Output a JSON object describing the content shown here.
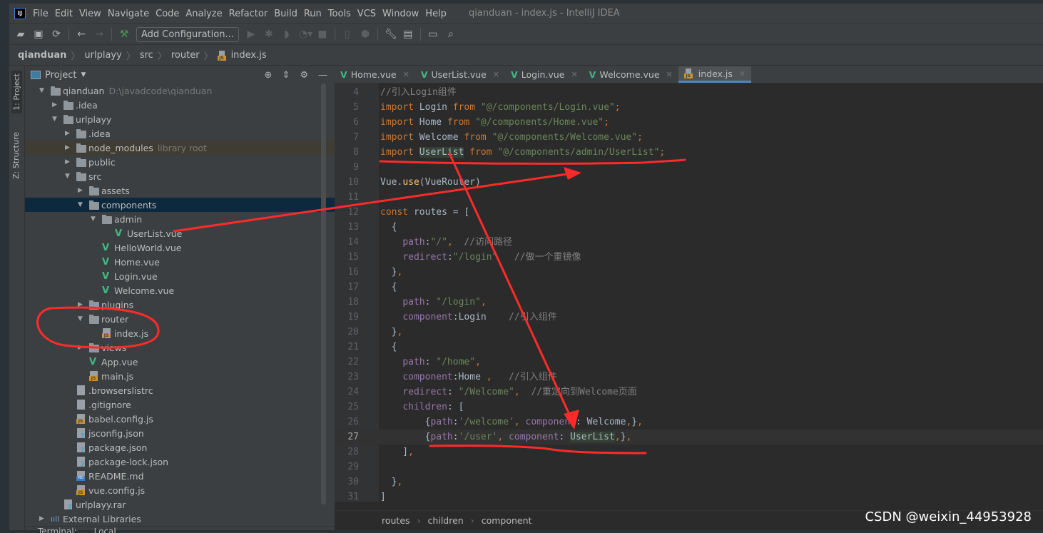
{
  "menubar": {
    "items": [
      "File",
      "Edit",
      "View",
      "Navigate",
      "Code",
      "Analyze",
      "Refactor",
      "Build",
      "Run",
      "Tools",
      "VCS",
      "Window",
      "Help"
    ],
    "window_title": "qianduan - index.js - IntelliJ IDEA"
  },
  "toolbar": {
    "add_configuration": "Add Configuration..."
  },
  "breadcrumb": [
    "qianduan",
    "urlplayy",
    "src",
    "router",
    "index.js"
  ],
  "left_strip": {
    "project": "1: Project",
    "structure": "Z: Structure"
  },
  "project_panel": {
    "title": "Project",
    "tree": [
      {
        "label": "qianduan",
        "extra": "D:\\javadcode\\qianduan",
        "level": 0,
        "type": "folder",
        "expanded": true
      },
      {
        "label": ".idea",
        "level": 1,
        "type": "folder",
        "expanded": false
      },
      {
        "label": "urlplayy",
        "level": 1,
        "type": "folder",
        "expanded": true
      },
      {
        "label": ".idea",
        "level": 2,
        "type": "folder",
        "expanded": false
      },
      {
        "label": "node_modules",
        "extra": "library root",
        "level": 2,
        "type": "folder",
        "expanded": false,
        "state": "library"
      },
      {
        "label": "public",
        "level": 2,
        "type": "folder",
        "expanded": false
      },
      {
        "label": "src",
        "level": 2,
        "type": "folder",
        "expanded": true
      },
      {
        "label": "assets",
        "level": 3,
        "type": "folder",
        "expanded": false
      },
      {
        "label": "components",
        "level": 3,
        "type": "folder",
        "expanded": true,
        "state": "selected"
      },
      {
        "label": "admin",
        "level": 4,
        "type": "folder",
        "expanded": true
      },
      {
        "label": "UserList.vue",
        "level": 5,
        "type": "vue"
      },
      {
        "label": "HelloWorld.vue",
        "level": 4,
        "type": "vue"
      },
      {
        "label": "Home.vue",
        "level": 4,
        "type": "vue"
      },
      {
        "label": "Login.vue",
        "level": 4,
        "type": "vue"
      },
      {
        "label": "Welcome.vue",
        "level": 4,
        "type": "vue"
      },
      {
        "label": "plugins",
        "level": 3,
        "type": "folder",
        "expanded": false
      },
      {
        "label": "router",
        "level": 3,
        "type": "folder",
        "expanded": true
      },
      {
        "label": "index.js",
        "level": 4,
        "type": "js"
      },
      {
        "label": "views",
        "level": 3,
        "type": "folder",
        "expanded": false
      },
      {
        "label": "App.vue",
        "level": 3,
        "type": "vue"
      },
      {
        "label": "main.js",
        "level": 3,
        "type": "js"
      },
      {
        "label": ".browserslistrc",
        "level": 2,
        "type": "file"
      },
      {
        "label": ".gitignore",
        "level": 2,
        "type": "file"
      },
      {
        "label": "babel.config.js",
        "level": 2,
        "type": "js"
      },
      {
        "label": "jsconfig.json",
        "level": 2,
        "type": "json"
      },
      {
        "label": "package.json",
        "level": 2,
        "type": "json"
      },
      {
        "label": "package-lock.json",
        "level": 2,
        "type": "json"
      },
      {
        "label": "README.md",
        "level": 2,
        "type": "md"
      },
      {
        "label": "vue.config.js",
        "level": 2,
        "type": "js"
      },
      {
        "label": "urlplayy.rar",
        "level": 1,
        "type": "unknown"
      },
      {
        "label": "External Libraries",
        "level": 0,
        "type": "libraries",
        "expanded": false
      }
    ]
  },
  "bottom_tool": {
    "label": "Terminal:",
    "tab": "Local"
  },
  "editor": {
    "tabs": [
      {
        "label": "Home.vue",
        "type": "vue"
      },
      {
        "label": "UserList.vue",
        "type": "vue"
      },
      {
        "label": "Login.vue",
        "type": "vue"
      },
      {
        "label": "Welcome.vue",
        "type": "vue"
      },
      {
        "label": "index.js",
        "type": "js",
        "active": true
      }
    ],
    "current_line": 27,
    "lines": [
      {
        "n": 4,
        "html": "<span class=\"cm\">//引入Login组件</span>"
      },
      {
        "n": 5,
        "html": "<span class=\"kw\">import</span> Login <span class=\"kw\">from</span> <span class=\"str\">\"@/components/Login.vue\"</span><span class=\"kw\">;</span>"
      },
      {
        "n": 6,
        "html": "<span class=\"kw\">import</span> Home <span class=\"kw\">from</span> <span class=\"str\">\"@/components/Home.vue\"</span><span class=\"kw\">;</span>"
      },
      {
        "n": 7,
        "html": "<span class=\"kw\">import</span> Welcome <span class=\"kw\">from</span> <span class=\"str\">\"@/components/Welcome.vue\"</span><span class=\"kw\">;</span>"
      },
      {
        "n": 8,
        "html": "<span class=\"kw\">import</span> <span class=\"hl\">UserList</span> <span class=\"kw\">from</span> <span class=\"str\">\"@/components/admin/UserList\"</span><span class=\"kw\">;</span>"
      },
      {
        "n": 9,
        "html": ""
      },
      {
        "n": 10,
        "html": "Vue.<span class=\"fn\">use</span>(VueRouter)"
      },
      {
        "n": 11,
        "html": ""
      },
      {
        "n": 12,
        "html": "<span class=\"kw\">const</span> routes = ["
      },
      {
        "n": 13,
        "html": "  {"
      },
      {
        "n": 14,
        "html": "    <span class=\"prop\">path</span>:<span class=\"str\">\"/\"</span><span class=\"kw\">,</span>  <span class=\"cm\">//访问路径</span>"
      },
      {
        "n": 15,
        "html": "    <span class=\"prop\">redirect</span>:<span class=\"str\">\"/login\"</span>   <span class=\"cm\">//做一个重镜像</span>"
      },
      {
        "n": 16,
        "html": "  }<span class=\"kw\">,</span>"
      },
      {
        "n": 17,
        "html": "  {"
      },
      {
        "n": 18,
        "html": "    <span class=\"prop\">path</span>: <span class=\"str\">\"/login\"</span><span class=\"kw\">,</span>"
      },
      {
        "n": 19,
        "html": "    <span class=\"prop\">component</span>:Login    <span class=\"cm\">//引入组件</span>"
      },
      {
        "n": 20,
        "html": "  }<span class=\"kw\">,</span>"
      },
      {
        "n": 21,
        "html": "  {"
      },
      {
        "n": 22,
        "html": "    <span class=\"prop\">path</span>: <span class=\"str\">\"/home\"</span><span class=\"kw\">,</span>"
      },
      {
        "n": 23,
        "html": "    <span class=\"prop\">component</span>:Home <span class=\"kw\">,</span>   <span class=\"cm\">//引入组件</span>"
      },
      {
        "n": 24,
        "html": "    <span class=\"prop\">redirect</span>: <span class=\"str\">\"/Welcome\"</span><span class=\"kw\">,</span>  <span class=\"cm\">//重定向到Welcome页面</span>"
      },
      {
        "n": 25,
        "html": "    <span class=\"prop\">children</span>: ["
      },
      {
        "n": 26,
        "html": "        {<span class=\"prop\">path</span>:<span class=\"str\">'/welcome'</span><span class=\"kw\">,</span> <span class=\"prop\">component</span>: Welcome<span class=\"kw\">,</span>}<span class=\"kw\">,</span>"
      },
      {
        "n": 27,
        "html": "        {<span class=\"prop\">path</span>:<span class=\"str\">'/user'</span><span class=\"kw\">,</span> <span class=\"prop\">component</span>: <span class=\"hl\">UserList</span><span class=\"kw\">,</span>}<span class=\"kw\">,</span>"
      },
      {
        "n": 28,
        "html": "    ]<span class=\"kw\">,</span>"
      },
      {
        "n": 29,
        "html": ""
      },
      {
        "n": 30,
        "html": "  }<span class=\"kw\">,</span>"
      },
      {
        "n": 31,
        "html": "]"
      }
    ],
    "breadcrumb": [
      "routes",
      "children",
      "component"
    ]
  },
  "watermark": "CSDN @weixin_44953928",
  "colors": {
    "annotation": "#ff2a2a",
    "vue": "#42b883",
    "selection": "#0d293e"
  }
}
